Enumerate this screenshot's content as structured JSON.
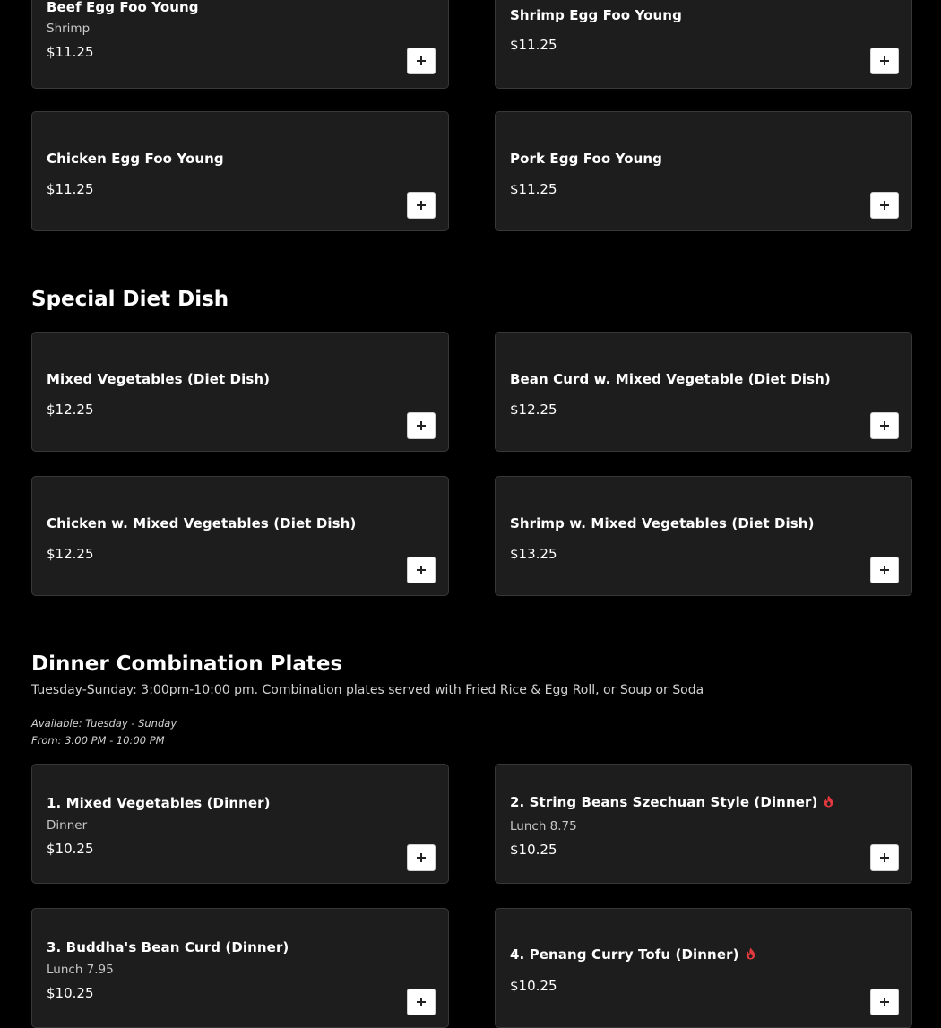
{
  "colors": {
    "background": "#000000",
    "card": "#1d1d1d",
    "card_border": "#383838",
    "spicy": "#e0393e"
  },
  "egg_foo_young": [
    {
      "name": "Beef Egg Foo Young",
      "subtitle": "Shrimp",
      "price": "$11.25"
    },
    {
      "name": "Shrimp Egg Foo Young",
      "price": "$11.25"
    },
    {
      "name": "Chicken Egg Foo Young",
      "price": "$11.25"
    },
    {
      "name": "Pork Egg Foo Young",
      "price": "$11.25"
    }
  ],
  "special_diet": {
    "title": "Special Diet Dish",
    "items": [
      {
        "name": "Mixed Vegetables (Diet Dish)",
        "price": "$12.25"
      },
      {
        "name": "Bean Curd w. Mixed Vegetable (Diet Dish)",
        "price": "$12.25"
      },
      {
        "name": "Chicken w. Mixed Vegetables (Diet Dish)",
        "price": "$12.25"
      },
      {
        "name": "Shrimp w. Mixed Vegetables (Diet Dish)",
        "price": "$13.25"
      }
    ]
  },
  "dinner_combo": {
    "title": "Dinner Combination Plates",
    "description": "Tuesday-Sunday: 3:00pm-10:00 pm. Combination plates served with Fried Rice & Egg Roll, or Soup or Soda",
    "available": "Available: Tuesday - Sunday",
    "from": "From: 3:00 PM - 10:00 PM",
    "items": [
      {
        "name": "1. Mixed Vegetables (Dinner)",
        "subtitle": "Dinner",
        "price": "$10.25",
        "spicy": false
      },
      {
        "name": "2. String Beans Szechuan Style (Dinner)",
        "subtitle": "Lunch 8.75",
        "price": "$10.25",
        "spicy": true
      },
      {
        "name": "3. Buddha's Bean Curd (Dinner)",
        "subtitle": "Lunch 7.95",
        "price": "$10.25",
        "spicy": false
      },
      {
        "name": "4. Penang Curry Tofu (Dinner)",
        "price": "$10.25",
        "spicy": true
      }
    ]
  },
  "icons": {
    "add": "plus-icon",
    "spicy": "flame-icon"
  }
}
